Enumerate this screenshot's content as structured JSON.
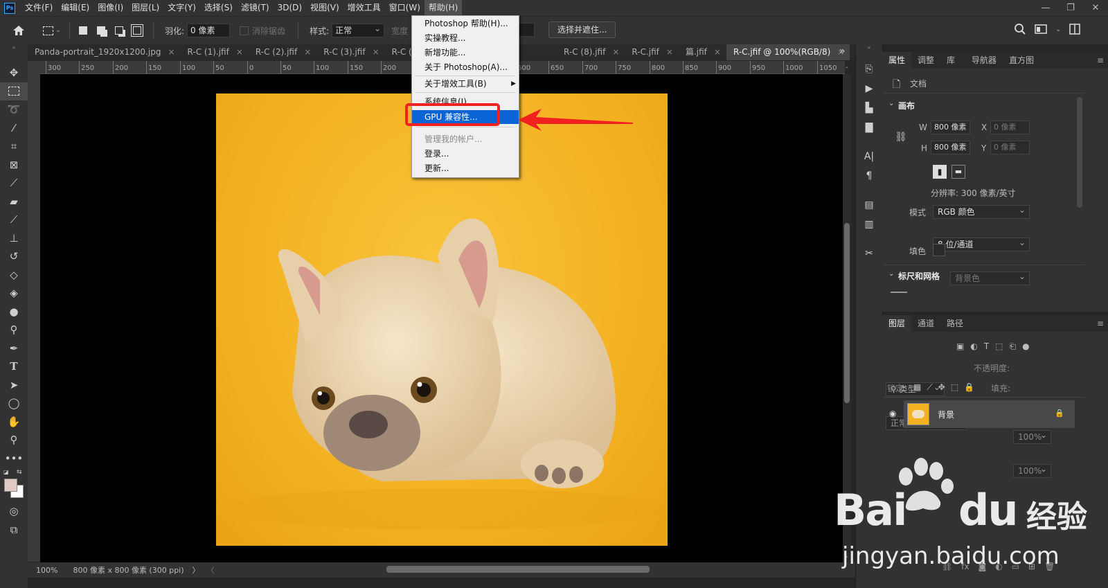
{
  "menu": {
    "logo": "Ps",
    "items": [
      "文件(F)",
      "编辑(E)",
      "图像(I)",
      "图层(L)",
      "文字(Y)",
      "选择(S)",
      "滤镜(T)",
      "3D(D)",
      "视图(V)",
      "增效工具",
      "窗口(W)",
      "帮助(H)"
    ],
    "active_index": 11
  },
  "window_controls": {
    "minimize": "—",
    "restore": "❐",
    "close": "✕"
  },
  "options": {
    "feather_label": "羽化:",
    "feather_value": "0 像素",
    "antialias_label": "消除锯齿",
    "style_label": "样式:",
    "style_value": "正常",
    "width_label": "宽度",
    "select_mask_button": "选择并遮住..."
  },
  "tabs": [
    {
      "label": "Panda-portrait_1920x1200.jpg",
      "close": "×"
    },
    {
      "label": "R-C (1).jfif",
      "close": "×"
    },
    {
      "label": "R-C (2).jfif",
      "close": "×"
    },
    {
      "label": "R-C (3).jfif",
      "close": "×"
    },
    {
      "label": "R-C (4).jfif",
      "close": "×"
    },
    {
      "label": "R-C (8).jfif",
      "close": "×"
    },
    {
      "label": "R-C.jfif",
      "close": "×"
    },
    {
      "label": "篇.jfif",
      "close": "×"
    },
    {
      "label": "R-C.jfif @ 100%(RGB/8)",
      "close": "×"
    }
  ],
  "ruler_ticks": [
    "300",
    "250",
    "200",
    "150",
    "100",
    "50",
    "0",
    "50",
    "100",
    "150",
    "200",
    "250",
    "300",
    "550",
    "600",
    "650",
    "700",
    "750",
    "800",
    "850",
    "900",
    "950",
    "1000",
    "1050"
  ],
  "help_menu": {
    "items": [
      {
        "label": "Photoshop 帮助(H)...",
        "state": "normal"
      },
      {
        "label": "实操教程...",
        "state": "normal"
      },
      {
        "label": "新增功能...",
        "state": "normal"
      },
      {
        "label": "关于 Photoshop(A)...",
        "state": "normal"
      },
      {
        "label": "关于增效工具(B)",
        "state": "normal",
        "submenu": "▶"
      },
      {
        "label": "系统信息(I)...",
        "state": "normal"
      },
      {
        "label": "GPU 兼容性...",
        "state": "selected"
      },
      {
        "label": "管理我的帐户...",
        "state": "disabled"
      },
      {
        "label": "登录...",
        "state": "normal"
      },
      {
        "label": "更新...",
        "state": "normal"
      }
    ]
  },
  "status": {
    "zoom": "100%",
    "doc_info": "800 像素 x 800 像素 (300 ppi)",
    "chevron": "〉",
    "left": "〈"
  },
  "properties": {
    "tabs": [
      "属性",
      "调整",
      "库",
      "导航器",
      "直方图"
    ],
    "doc_label": "文档",
    "canvas_section": "画布",
    "w_label": "W",
    "w_value": "800 像素",
    "h_label": "H",
    "h_value": "800 像素",
    "x_label": "X",
    "x_value": "0 像素",
    "y_label": "Y",
    "y_value": "0 像素",
    "resolution": "分辨率: 300 像素/英寸",
    "mode_label": "模式",
    "mode_value": "RGB 颜色",
    "depth_value": "8 位/通道",
    "fill_label": "填色",
    "fill_value": "背景色",
    "rulers_section": "标尺和网格"
  },
  "layers": {
    "tabs": [
      "图层",
      "通道",
      "路径"
    ],
    "filter_value": "类型",
    "blend_value": "正常",
    "opacity_label": "不透明度:",
    "opacity_value": "100%",
    "lock_label": "锁定:",
    "fill_label": "填充:",
    "fill_value": "100%",
    "layer_name": "背景"
  },
  "watermark": {
    "brand": "Bai",
    "brand2": "du",
    "cn": "经验",
    "url": "jingyan.baidu.com"
  },
  "colors": {
    "accent": "#0a64d6",
    "highlight": "#f0211e",
    "background_yellow": "#f3b222"
  }
}
